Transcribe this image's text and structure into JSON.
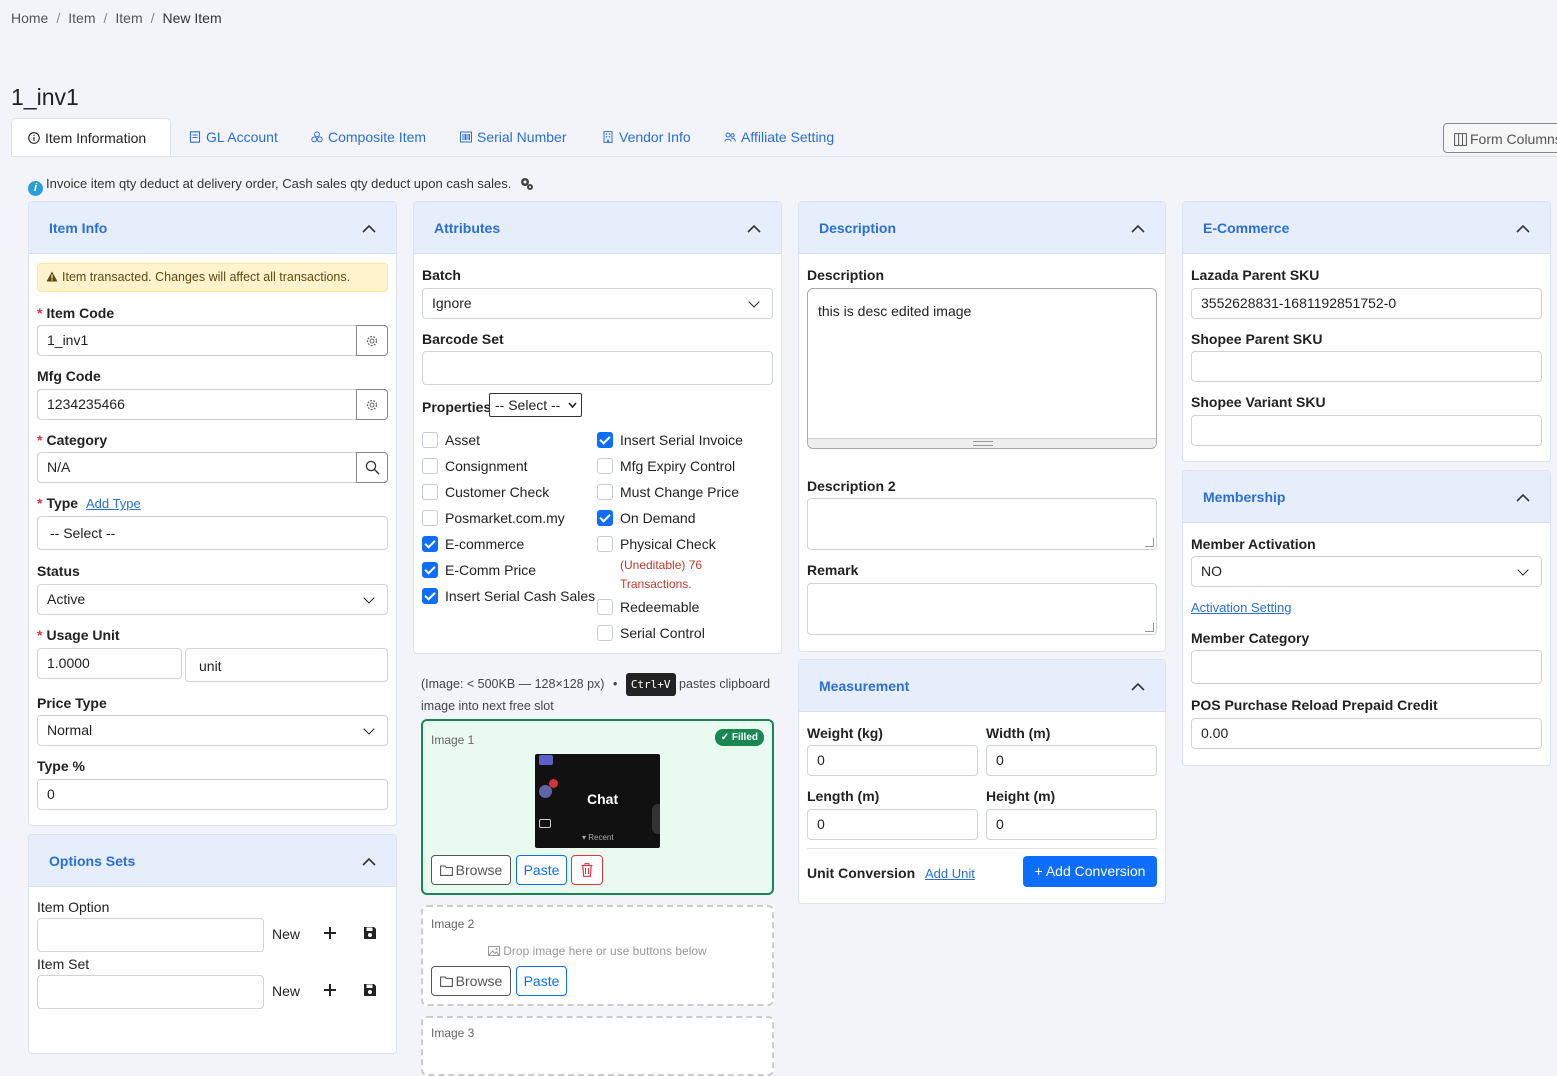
{
  "breadcrumb": [
    "Home",
    "Item",
    "Item",
    "New Item"
  ],
  "page_title": "1_inv1",
  "tabs": [
    {
      "label": "Item Information",
      "icon": "info-circle-icon",
      "active": true
    },
    {
      "label": "GL Account",
      "icon": "gl-account-icon"
    },
    {
      "label": "Composite Item",
      "icon": "boxes-icon"
    },
    {
      "label": "Serial Number",
      "icon": "barcode-icon"
    },
    {
      "label": "Vendor Info",
      "icon": "building-icon"
    },
    {
      "label": "Affiliate Setting",
      "icon": "people-icon"
    }
  ],
  "form_columns_label": "Form Columns",
  "info_text": "Invoice item qty deduct at delivery order, Cash sales qty deduct upon cash sales.",
  "item_info": {
    "title": "Item Info",
    "warning": "Item transacted. Changes will affect all transactions.",
    "item_code_label": "Item Code",
    "item_code": "1_inv1",
    "mfg_code_label": "Mfg Code",
    "mfg_code": "1234235466",
    "category_label": "Category",
    "category": "N/A",
    "type_label": "Type",
    "add_type": "Add Type",
    "type_value": "-- Select --",
    "status_label": "Status",
    "status_value": "Active",
    "usage_unit_label": "Usage Unit",
    "usage_qty": "1.0000",
    "usage_unit": "unit",
    "price_type_label": "Price Type",
    "price_type_value": "Normal",
    "type_pct_label": "Type %",
    "type_pct_value": "0"
  },
  "options_sets": {
    "title": "Options Sets",
    "item_option_label": "Item Option",
    "item_set_label": "Item Set",
    "new_label": "New"
  },
  "attributes": {
    "title": "Attributes",
    "batch_label": "Batch",
    "batch_value": "Ignore",
    "barcode_label": "Barcode Set",
    "properties_label": "Properties",
    "properties_select": "-- Select --",
    "left": [
      {
        "label": "Asset",
        "checked": false
      },
      {
        "label": "Consignment",
        "checked": false
      },
      {
        "label": "Customer Check",
        "checked": false
      },
      {
        "label": "Posmarket.com.my",
        "checked": false
      },
      {
        "label": "E-commerce",
        "checked": true
      },
      {
        "label": "E-Comm Price",
        "checked": true
      },
      {
        "label": "Insert Serial Cash Sales",
        "checked": true
      }
    ],
    "right": [
      {
        "label": "Insert Serial Invoice",
        "checked": true
      },
      {
        "label": "Mfg Expiry Control",
        "checked": false
      },
      {
        "label": "Must Change Price",
        "checked": false
      },
      {
        "label": "On Demand",
        "checked": true
      },
      {
        "label": "Physical Check",
        "checked": false
      },
      {
        "label": "Redeemable",
        "checked": false
      },
      {
        "label": "Serial Control",
        "checked": false
      }
    ],
    "uneditable_note_1": "(Uneditable) 76",
    "uneditable_note_2": "Transactions."
  },
  "images": {
    "hint_1": "(Image: < 500KB — 128×128 px)",
    "hint_bullet": "•",
    "hint_kbd": "Ctrl+V",
    "hint_2": "pastes clipboard",
    "hint_3": "image into next free slot",
    "slot1_title": "Image 1",
    "slot1_badge": "✓ Filled",
    "thumb_text": "Chat",
    "thumb_recent": "▾ Recent",
    "slot2_title": "Image 2",
    "slot2_drop": "Drop image here or use buttons below",
    "slot3_title": "Image 3",
    "browse": "Browse",
    "paste": "Paste"
  },
  "description": {
    "title": "Description",
    "desc_label": "Description",
    "desc_value": "this is desc edited image",
    "desc2_label": "Description 2",
    "remark_label": "Remark"
  },
  "measurement": {
    "title": "Measurement",
    "weight_label": "Weight (kg)",
    "weight": "0",
    "width_label": "Width (m)",
    "width": "0",
    "length_label": "Length (m)",
    "length": "0",
    "height_label": "Height (m)",
    "height": "0",
    "unit_conv_label": "Unit Conversion",
    "add_unit": "Add Unit",
    "add_conversion": "+ Add Conversion"
  },
  "ecommerce": {
    "title": "E-Commerce",
    "lazada_label": "Lazada Parent SKU",
    "lazada_value": "3552628831-1681192851752-0",
    "shopee_parent_label": "Shopee Parent SKU",
    "shopee_variant_label": "Shopee Variant SKU"
  },
  "membership": {
    "title": "Membership",
    "activation_label": "Member Activation",
    "activation_value": "NO",
    "activation_setting": "Activation Setting",
    "category_label": "Member Category",
    "reload_label": "POS Purchase Reload Prepaid Credit",
    "reload_value": "0.00"
  },
  "colors": {
    "accent": "#2a6fd6",
    "primary": "#0d6efd",
    "success": "#198754",
    "danger": "#dc3545"
  }
}
